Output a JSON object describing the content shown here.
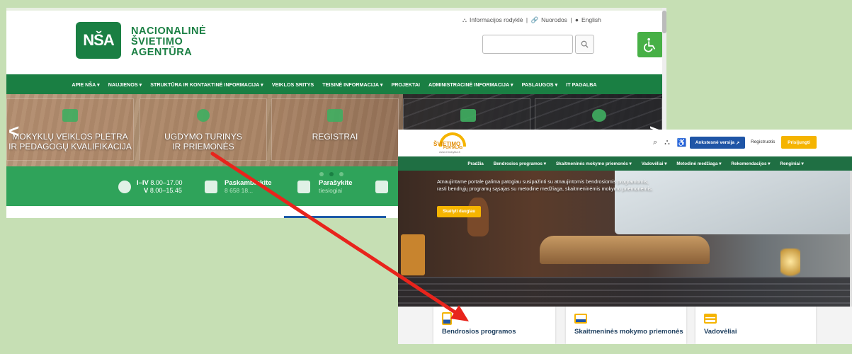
{
  "nsa": {
    "logo_mark": "NŠA",
    "logo_lines": [
      "NACIONALINĖ",
      "ŠVIETIMO",
      "AGENTŪRA"
    ],
    "toplinks": [
      "Informacijos rodyklė",
      "Nuorodos",
      "English"
    ],
    "menu": [
      "APIE NŠA ▾",
      "NAUJIENOS ▾",
      "STRUKTŪRA IR KONTAKTINĖ INFORMACIJA ▾",
      "VEIKLOS SRITYS",
      "TEISINĖ INFORMACIJA ▾",
      "PROJEKTAI",
      "ADMINISTRACINĖ INFORMACIJA ▾",
      "PASLAUGOS ▾",
      "IT PAGALBA"
    ],
    "tiles": [
      {
        "line1": "MOKYKLŲ VEIKLOS PLĖTRA",
        "line2": "IR PEDAGOGŲ KVALIFIKACIJA"
      },
      {
        "line1": "UGDYMO TURINYS",
        "line2": "IR PRIEMONĖS"
      },
      {
        "line1": "REGISTRAI",
        "line2": ""
      }
    ],
    "hours": {
      "days1": "I–IV",
      "time1": "8.00–17.00",
      "days2": "V",
      "time2": "8.00–15.45"
    },
    "call": {
      "title": "Paskambinkite",
      "sub": "8 658 18..."
    },
    "write": {
      "title": "Parašykite",
      "sub": "tiesiogiai"
    }
  },
  "portal": {
    "logo": {
      "line1": "ŠVIETIMO",
      "line2": "PORTALAS",
      "url": "www.emokykla.lt"
    },
    "header_buttons": {
      "old_version": "Ankstesnė versija",
      "register": "Registruotis",
      "login": "Prisijungti"
    },
    "nav": [
      "Pradžia",
      "Bendrosios programos ▾",
      "Skaitmeninės mokymo priemonės ▾",
      "Vadovėliai ▾",
      "Metodinė medžiaga ▾",
      "Rekomendacijos ▾",
      "Renginiai ▾"
    ],
    "hero_text": "Atnaujintame portale galima patogiau susipažinti su atnaujintomis bendrosiomis programomis, rasti bendrųjų programų sąsajas su metodine medžiaga, skaitmeninėmis mokymo priemonėmis.",
    "hero_button": "Skaityti daugiau",
    "cards": [
      "Bendrosios programos",
      "Skaitmeninės mokymo priemonės",
      "Vadovėliai"
    ]
  },
  "colors": {
    "nsa_green": "#1a7f43",
    "portal_green": "#1f6f43",
    "portal_yellow": "#f5b400",
    "arrow": "#e8241c"
  }
}
